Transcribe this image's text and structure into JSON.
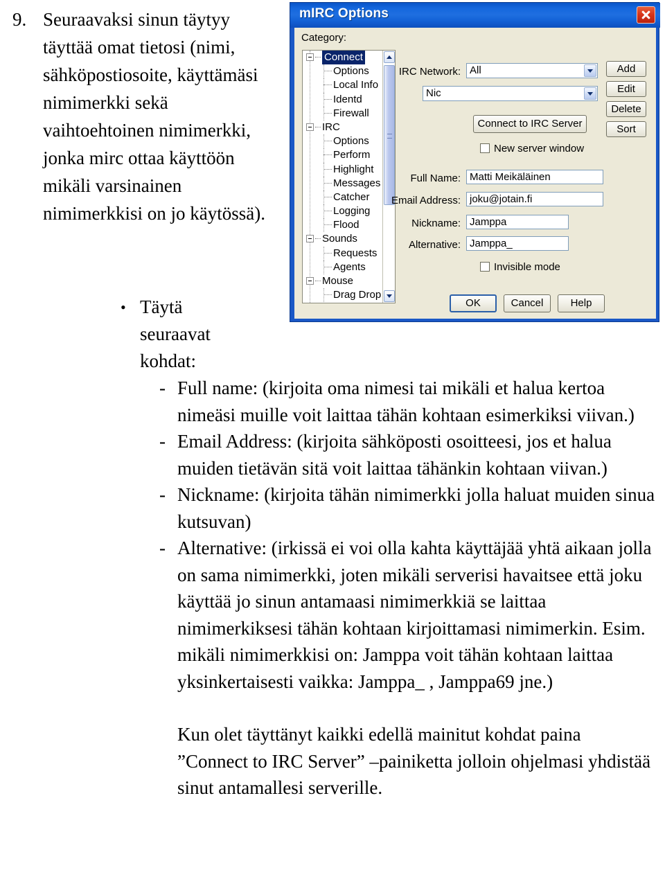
{
  "document": {
    "number": "9.",
    "intro": "Seuraavaksi sinun täytyy täyttää omat tietosi (nimi, sähköpostiosoite, käyttämäsi nimimerkki sekä vaihtoehtoinen nimimerkki, jonka mirc ottaa käyttöön mikäli varsinainen nimimerkkisi on jo käytössä).",
    "bullet_marker": "•",
    "bullet_text": "Täytä seuraavat kohdat:",
    "dash_marker": "-",
    "items": [
      "Full name: (kirjoita oma nimesi tai mikäli et halua kertoa nimeäsi muille voit laittaa tähän kohtaan esimerkiksi viivan.)",
      "Email Address: (kirjoita sähköposti osoitteesi, jos et halua muiden tietävän sitä voit laittaa tähänkin kohtaan viivan.)",
      "Nickname: (kirjoita tähän nimimerkki jolla haluat muiden sinua kutsuvan)",
      "Alternative: (irkissä ei voi olla kahta käyttäjää yhtä aikaan jolla on sama nimimerkki, joten mikäli serverisi havaitsee että joku käyttää jo sinun antamaasi nimimerkkiä se laittaa nimimerkiksesi tähän kohtaan kirjoittamasi nimimerkin. Esim. mikäli nimimerkkisi on: Jamppa voit tähän kohtaan laittaa yksinkertaisesti vaikka: Jamppa_ , Jamppa69 jne.)"
    ],
    "closing": "Kun olet täyttänyt kaikki edellä mainitut kohdat paina ”Connect to IRC Server” –painiketta jolloin ohjelmasi yhdistää sinut antamallesi serverille."
  },
  "dialog": {
    "title": "mIRC Options",
    "close_icon": "close-icon",
    "category_label": "Category:",
    "tree": [
      {
        "label": "Connect",
        "level": "root",
        "selected": true,
        "expander": true
      },
      {
        "label": "Options",
        "level": "child",
        "selected": false,
        "expander": false
      },
      {
        "label": "Local Info",
        "level": "child",
        "selected": false,
        "expander": false
      },
      {
        "label": "Identd",
        "level": "child",
        "selected": false,
        "expander": false
      },
      {
        "label": "Firewall",
        "level": "child",
        "selected": false,
        "expander": false
      },
      {
        "label": "IRC",
        "level": "root",
        "selected": false,
        "expander": true
      },
      {
        "label": "Options",
        "level": "child",
        "selected": false,
        "expander": false
      },
      {
        "label": "Perform",
        "level": "child",
        "selected": false,
        "expander": false
      },
      {
        "label": "Highlight",
        "level": "child",
        "selected": false,
        "expander": false
      },
      {
        "label": "Messages",
        "level": "child",
        "selected": false,
        "expander": false
      },
      {
        "label": "Catcher",
        "level": "child",
        "selected": false,
        "expander": false
      },
      {
        "label": "Logging",
        "level": "child",
        "selected": false,
        "expander": false
      },
      {
        "label": "Flood",
        "level": "child",
        "selected": false,
        "expander": false
      },
      {
        "label": "Sounds",
        "level": "root",
        "selected": false,
        "expander": true
      },
      {
        "label": "Requests",
        "level": "child",
        "selected": false,
        "expander": false
      },
      {
        "label": "Agents",
        "level": "child",
        "selected": false,
        "expander": false
      },
      {
        "label": "Mouse",
        "level": "root",
        "selected": false,
        "expander": true
      },
      {
        "label": "Drag Drop",
        "level": "child",
        "selected": false,
        "expander": false
      }
    ],
    "network_label": "IRC Network:",
    "network_value": "All",
    "server_value": "Nic",
    "connect_button": "Connect to IRC Server",
    "new_server_window_label": "New server window",
    "side_buttons": [
      "Add",
      "Edit",
      "Delete",
      "Sort"
    ],
    "full_name_label": "Full Name:",
    "full_name_value": "Matti Meikäläinen",
    "email_label": "Email Address:",
    "email_value": "joku@jotain.fi",
    "nickname_label": "Nickname:",
    "nickname_value": "Jamppa",
    "alternative_label": "Alternative:",
    "alternative_value": "Jamppa_",
    "invisible_mode_label": "Invisible mode",
    "ok_button": "OK",
    "cancel_button": "Cancel",
    "help_button": "Help",
    "colors": {
      "title_bar": "#1466dd",
      "dialog_face": "#ece9d8",
      "frame": "#1a58c6",
      "selection": "#0a246a",
      "close_button": "#d9361b"
    }
  }
}
